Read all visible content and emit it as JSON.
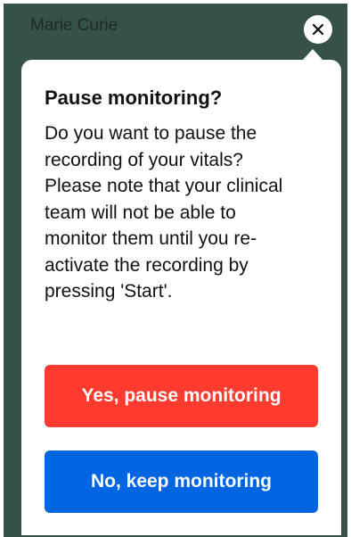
{
  "header": {
    "patient_name": "Marie Curie"
  },
  "dialog": {
    "title": "Pause monitoring?",
    "message": "Do you want to pause the recording of your vitals? Please note that your clinical team will not be able to monitor them until you re-activate the recording by pressing 'Start'.",
    "confirm_label": "Yes, pause monitoring",
    "cancel_label": "No, keep monitoring"
  },
  "icons": {
    "close": "close-icon"
  },
  "colors": {
    "backdrop": "#36504a",
    "confirm": "#ff3b30",
    "cancel": "#0065e0"
  }
}
